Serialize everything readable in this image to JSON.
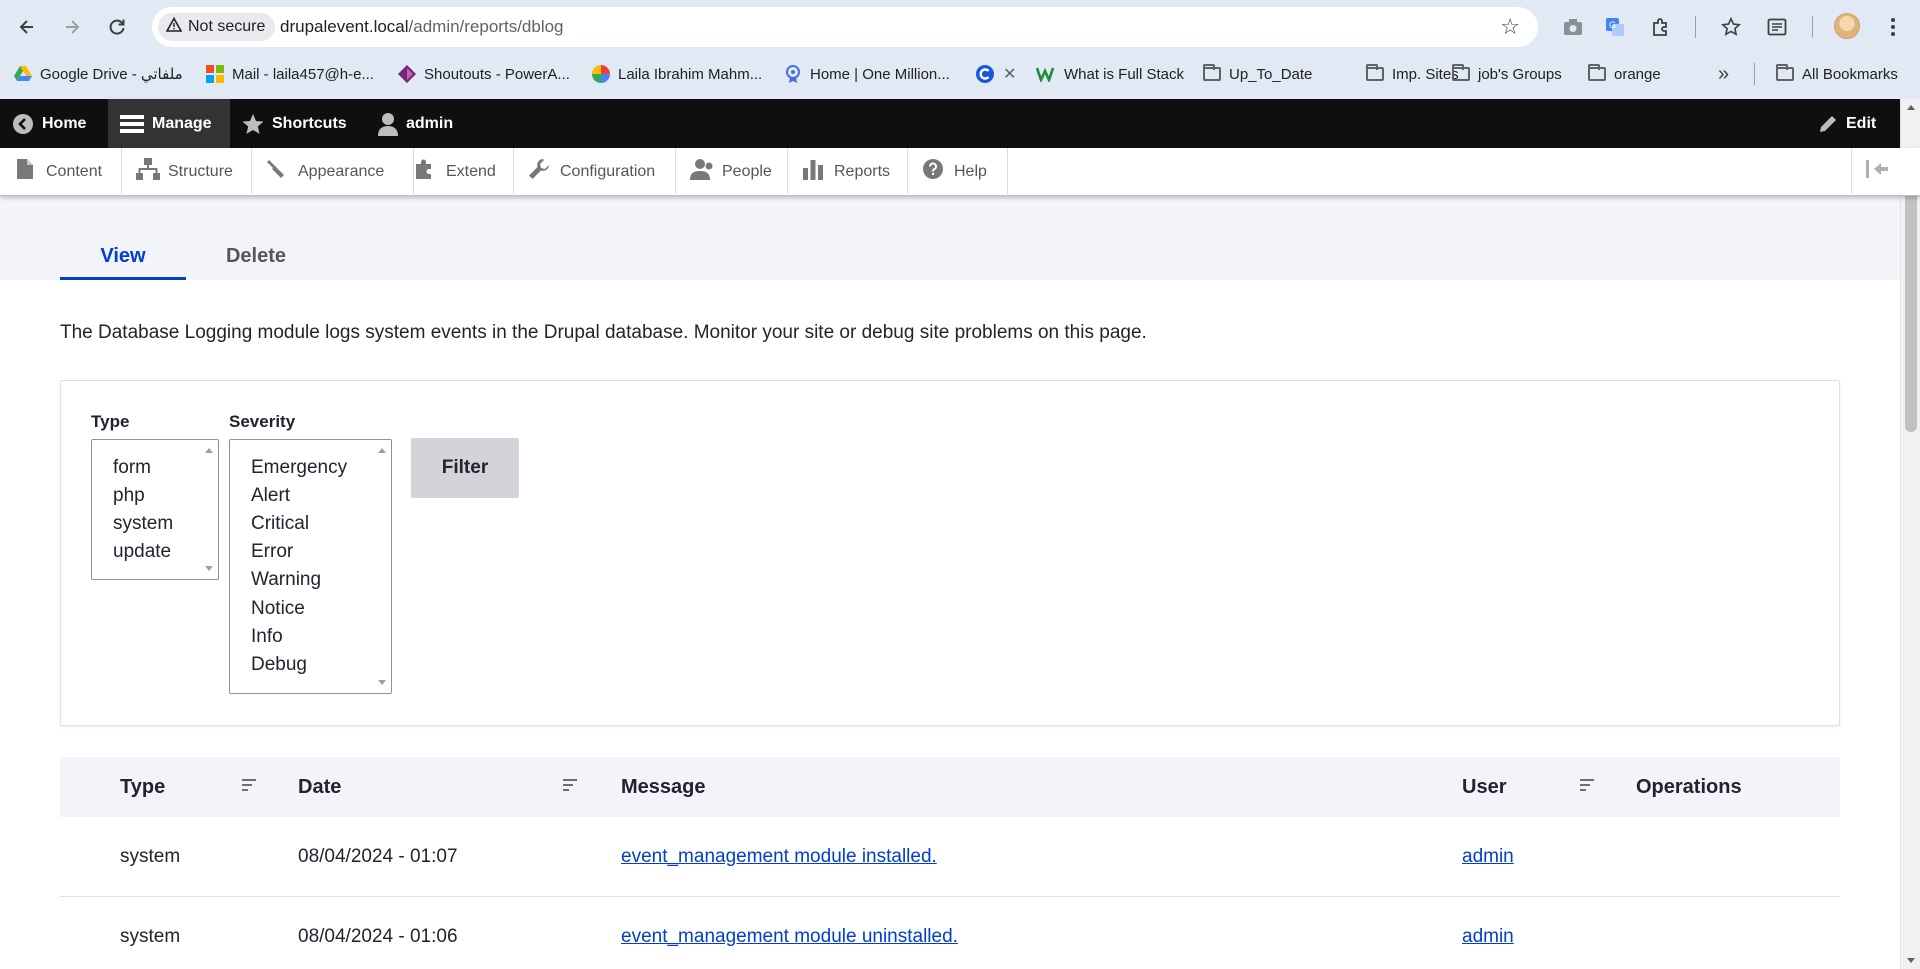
{
  "browser": {
    "security_label": "Not secure",
    "url_host": "drupalevent.local",
    "url_path": "/admin/reports/dblog",
    "bookmarks": [
      {
        "label": "Google Drive - ملفاتي",
        "icon": "google-drive-icon"
      },
      {
        "label": "Mail - laila457@h-e...",
        "icon": "outlook-mail-icon"
      },
      {
        "label": "Shoutouts - PowerA...",
        "icon": "power-apps-icon"
      },
      {
        "label": "Laila Ibrahim Mahm...",
        "icon": "pinwheel-icon"
      },
      {
        "label": "Home | One Million...",
        "icon": "one-million-icon"
      },
      {
        "label": "",
        "icon": "c-logo-icon"
      },
      {
        "label": "What is Full Stack",
        "icon": "w-logo-icon"
      },
      {
        "label": "Up_To_Date",
        "icon": "folder-icon"
      },
      {
        "label": "Imp. Sites",
        "icon": "folder-icon"
      },
      {
        "label": "job's Groups",
        "icon": "folder-icon"
      },
      {
        "label": "orange",
        "icon": "folder-icon"
      }
    ],
    "overflow_label": "»",
    "all_bookmarks_label": "All Bookmarks"
  },
  "toolbar": {
    "home": "Home",
    "manage": "Manage",
    "shortcuts": "Shortcuts",
    "user": "admin",
    "edit": "Edit"
  },
  "tray": {
    "items": [
      {
        "label": "Content",
        "icon": "file-icon"
      },
      {
        "label": "Structure",
        "icon": "sitemap-icon"
      },
      {
        "label": "Appearance",
        "icon": "paintbrush-icon"
      },
      {
        "label": "Extend",
        "icon": "puzzle-icon"
      },
      {
        "label": "Configuration",
        "icon": "wrench-icon"
      },
      {
        "label": "People",
        "icon": "person-icon"
      },
      {
        "label": "Reports",
        "icon": "bar-chart-icon"
      },
      {
        "label": "Help",
        "icon": "question-icon"
      }
    ]
  },
  "tabs": {
    "view": "View",
    "delete": "Delete"
  },
  "intro_text": "The Database Logging module logs system events in the Drupal database. Monitor your site or debug site problems on this page.",
  "filters": {
    "type_label": "Type",
    "type_options": [
      "form",
      "php",
      "system",
      "update"
    ],
    "severity_label": "Severity",
    "severity_options": [
      "Emergency",
      "Alert",
      "Critical",
      "Error",
      "Warning",
      "Notice",
      "Info",
      "Debug"
    ],
    "filter_button": "Filter"
  },
  "table": {
    "headers": {
      "type": "Type",
      "date": "Date",
      "message": "Message",
      "user": "User",
      "operations": "Operations"
    },
    "rows": [
      {
        "type": "system",
        "date": "08/04/2024 - 01:07",
        "message": "event_management module installed.",
        "user": "admin",
        "operations": ""
      },
      {
        "type": "system",
        "date": "08/04/2024 - 01:06",
        "message": "event_management module uninstalled.",
        "user": "admin",
        "operations": ""
      }
    ]
  },
  "colors": {
    "link": "#003ecc",
    "toolbar_bg": "#0f0f0f",
    "header_bg": "#f3f4f9"
  }
}
